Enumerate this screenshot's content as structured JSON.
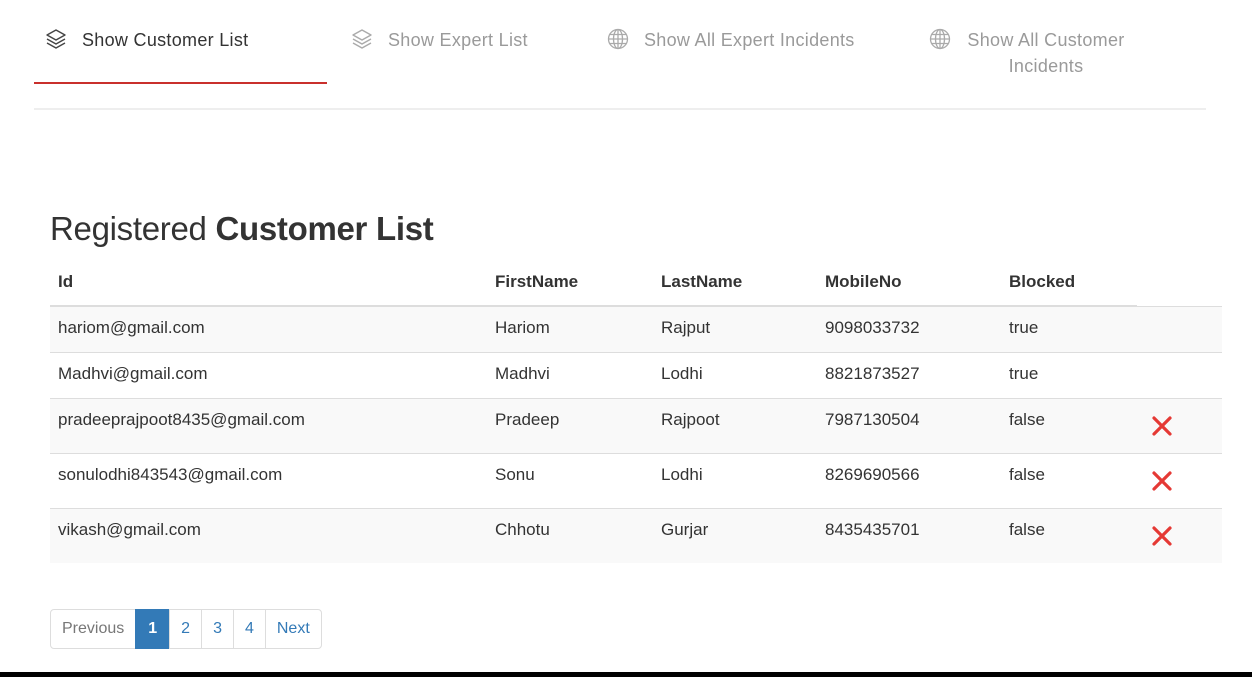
{
  "tabs": [
    {
      "label": "Show Customer List",
      "icon": "stack-icon",
      "active": true
    },
    {
      "label": "Show Expert List",
      "icon": "stack-icon",
      "active": false
    },
    {
      "label": "Show All Expert Incidents",
      "icon": "globe-icon",
      "active": false
    },
    {
      "label": "Show All Customer Incidents",
      "icon": "globe-icon",
      "active": false
    }
  ],
  "heading": {
    "prefix": "Registered",
    "bold": "Customer List"
  },
  "table": {
    "headers": [
      "Id",
      "FirstName",
      "LastName",
      "MobileNo",
      "Blocked"
    ],
    "rows": [
      {
        "id": "hariom@gmail.com",
        "first": "Hariom",
        "last": "Rajput",
        "mobile": "9098033732",
        "blocked": "true"
      },
      {
        "id": "Madhvi@gmail.com",
        "first": "Madhvi",
        "last": "Lodhi",
        "mobile": "8821873527",
        "blocked": "true"
      },
      {
        "id": "pradeeprajpoot8435@gmail.com",
        "first": "Pradeep",
        "last": "Rajpoot",
        "mobile": "7987130504",
        "blocked": "false"
      },
      {
        "id": "sonulodhi843543@gmail.com",
        "first": "Sonu",
        "last": "Lodhi",
        "mobile": "8269690566",
        "blocked": "false"
      },
      {
        "id": "vikash@gmail.com",
        "first": "Chhotu",
        "last": "Gurjar",
        "mobile": "8435435701",
        "blocked": "false"
      }
    ]
  },
  "pagination": {
    "previous": "Previous",
    "pages": [
      "1",
      "2",
      "3",
      "4"
    ],
    "current": "1",
    "next": "Next"
  },
  "colors": {
    "accent": "#c9302c",
    "link": "#337ab7",
    "delete": "#e53935"
  }
}
